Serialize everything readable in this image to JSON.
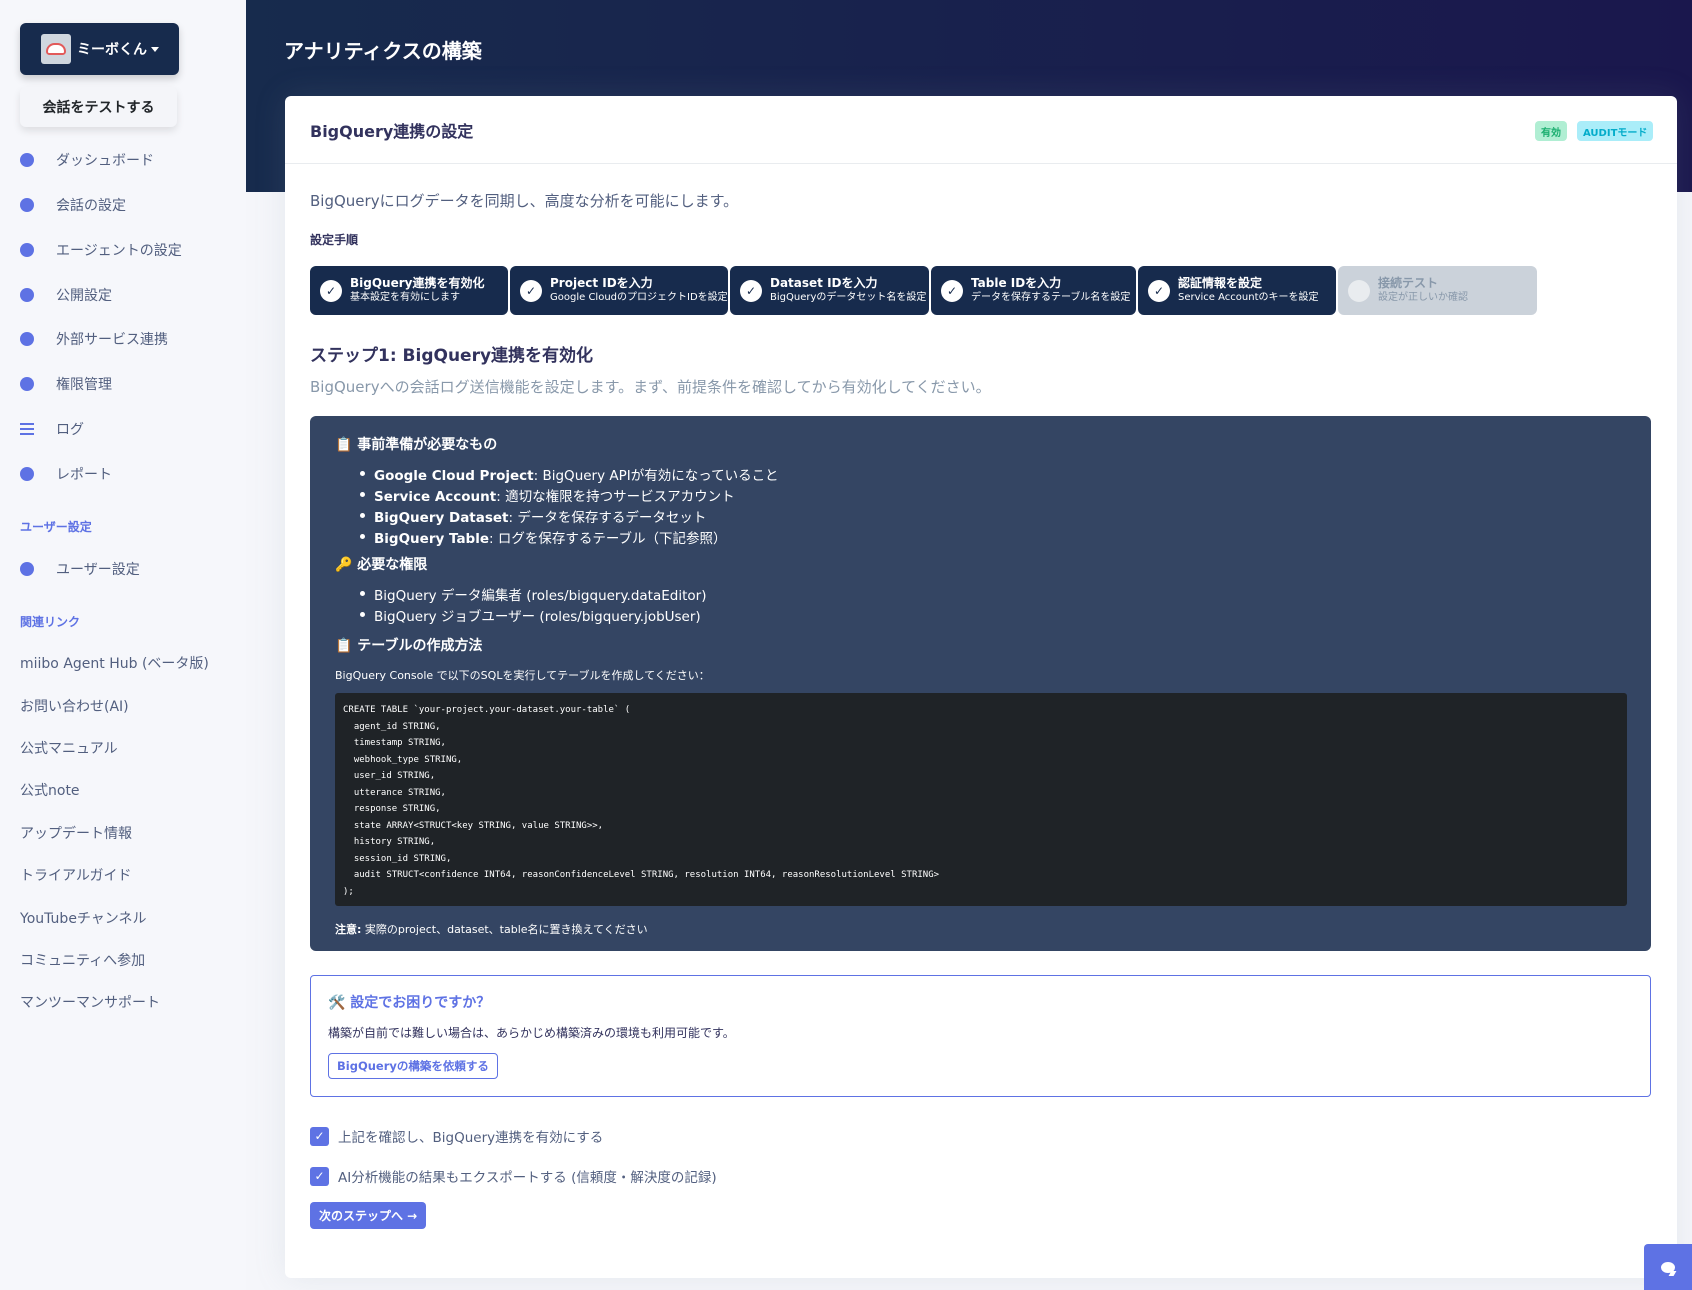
{
  "sidebar": {
    "brand_name": "ミーボくん",
    "test_button": "会話をテストする",
    "nav": [
      {
        "label": "ダッシュボード",
        "icon": "pie-chart-icon"
      },
      {
        "label": "会話の設定",
        "icon": "chat-bubble-icon"
      },
      {
        "label": "エージェントの設定",
        "icon": "smile-face-icon"
      },
      {
        "label": "公開設定",
        "icon": "globe-icon"
      },
      {
        "label": "外部サービス連携",
        "icon": "connection-icon"
      },
      {
        "label": "権限管理",
        "icon": "user-circle-icon"
      },
      {
        "label": "ログ",
        "icon": "list-icon"
      },
      {
        "label": "レポート",
        "icon": "compass-icon"
      }
    ],
    "user_section_title": "ユーザー設定",
    "user_item": "ユーザー設定",
    "links_section_title": "関連リンク",
    "links": [
      "miibo Agent Hub (ベータ版)",
      "お問い合わせ(AI)",
      "公式マニュアル",
      "公式note",
      "アップデート情報",
      "トライアルガイド",
      "YouTubeチャンネル",
      "コミュニティへ参加",
      "マンツーマンサポート"
    ]
  },
  "header": {
    "title": "アナリティクスの構築"
  },
  "card": {
    "title": "BigQuery連携の設定",
    "badges": [
      "有効",
      "AUDITモード"
    ],
    "intro": "BigQueryにログデータを同期し、高度な分析を可能にします。",
    "steps_label": "設定手順",
    "steps": [
      {
        "title": "BigQuery連携を有効化",
        "sub": "基本設定を有効にします",
        "done": true
      },
      {
        "title": "Project IDを入力",
        "sub": "Google CloudのプロジェクトIDを設定",
        "done": true
      },
      {
        "title": "Dataset IDを入力",
        "sub": "BigQueryのデータセット名を設定",
        "done": true
      },
      {
        "title": "Table IDを入力",
        "sub": "データを保存するテーブル名を設定",
        "done": true
      },
      {
        "title": "認証情報を設定",
        "sub": "Service Accountのキーを設定",
        "done": true
      },
      {
        "title": "接続テスト",
        "sub": "設定が正しいか確認",
        "done": false
      }
    ],
    "step_heading": "ステップ1: BigQuery連携を有効化",
    "step_desc": "BigQueryへの会話ログ送信機能を設定します。まず、前提条件を確認してから有効化してください。",
    "prereq": {
      "title": "📋 事前準備が必要なもの",
      "items": [
        {
          "bold": "Google Cloud Project",
          "text": ": BigQuery APIが有効になっていること"
        },
        {
          "bold": "Service Account",
          "text": ": 適切な権限を持つサービスアカウント"
        },
        {
          "bold": "BigQuery Dataset",
          "text": ": データを保存するデータセット"
        },
        {
          "bold": "BigQuery Table",
          "text": ": ログを保存するテーブル（下記参照）"
        }
      ]
    },
    "perms": {
      "title": "🔑 必要な権限",
      "items": [
        "BigQuery データ編集者 (roles/bigquery.dataEditor)",
        "BigQuery ジョブユーザー (roles/bigquery.jobUser)"
      ]
    },
    "table": {
      "title": "📋 テーブルの作成方法",
      "instruction": "BigQuery Console で以下のSQLを実行してテーブルを作成してください：",
      "sql": "CREATE TABLE `your-project.your-dataset.your-table` (\n  agent_id STRING,\n  timestamp STRING,\n  webhook_type STRING,\n  user_id STRING,\n  utterance STRING,\n  response STRING,\n  state ARRAY<STRUCT<key STRING, value STRING>>,\n  history STRING,\n  session_id STRING,\n  audit STRUCT<confidence INT64, reasonConfidenceLevel STRING, resolution INT64, reasonResolutionLevel STRING>\n);",
      "note_bold": "注意:",
      "note_text": " 実際のproject、dataset、table名に置き換えてください"
    },
    "help": {
      "title": "🛠️ 設定でお困りですか？",
      "text": "構築が自前では難しい場合は、あらかじめ構築済みの環境も利用可能です。",
      "button": "BigQueryの構築を依頼する"
    },
    "checkboxes": [
      {
        "label": "上記を確認し、BigQuery連携を有効にする",
        "checked": true
      },
      {
        "label": "AI分析機能の結果もエクスポートする (信頼度・解決度の記録)",
        "checked": true
      }
    ],
    "next_button": "次のステップへ →"
  },
  "colors": {
    "primary": "#5e72e4",
    "dark": "#172b4d",
    "panel": "#344563"
  }
}
